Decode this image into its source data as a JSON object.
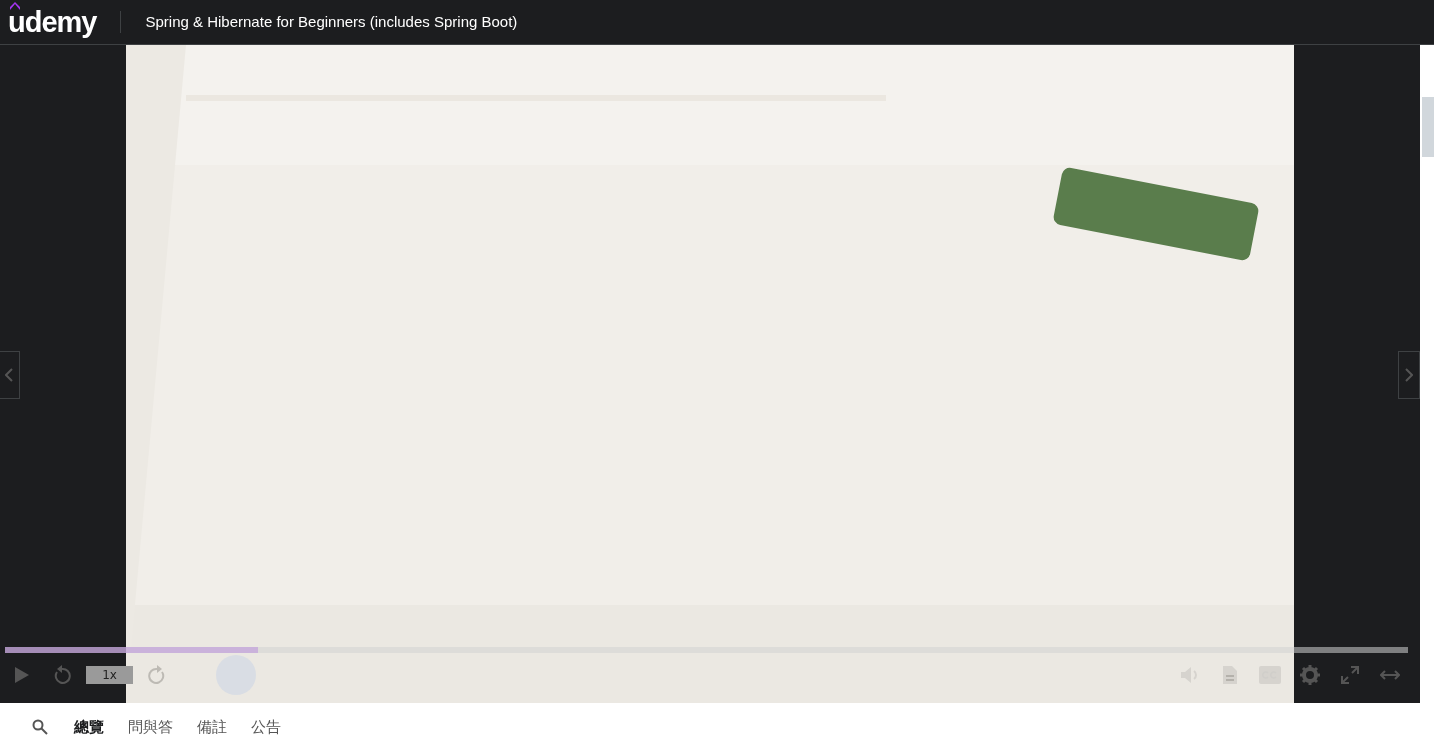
{
  "header": {
    "logo": "udemy",
    "course_title": "Spring & Hibernate for Beginners (includes Spring Boot)"
  },
  "video": {
    "kind": "picture",
    "progress": {
      "level": 0.18
    },
    "speed": "1x"
  },
  "tabs": [
    {
      "label": "總覽",
      "selected": true
    },
    {
      "label": "問與答",
      "selected": false
    },
    {
      "label": "備註",
      "selected": false
    },
    {
      "label": "公告",
      "selected": false
    }
  ]
}
